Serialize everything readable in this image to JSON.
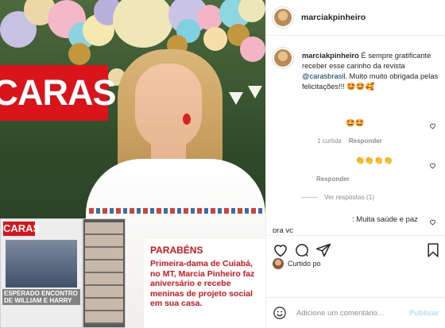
{
  "post": {
    "username": "marciakpinheiro",
    "image": {
      "brand": "CARAS",
      "mini_cover_brand": "CARAS",
      "mini_cover_headline": "ESPERADO ENCONTRO DE WILLIAM E HARRY",
      "caption_title": "PARABÉNS",
      "caption_text": "Primeira-dama de Cuiabá, no MT, Marcia Pinheiro faz aniversário e recebe meninas de projeto social em sua casa."
    },
    "caption": {
      "username": "marciakpinheiro",
      "text_before": "É sempre gratificante receber esse carinho da revista",
      "mention": "@carasbrasil",
      "text_after": ". Muito muito obrigada pelas felicitações!!! 🤩🤩🥰"
    },
    "comments": [
      {
        "text": "🤩🤩",
        "meta_likes": "1 curtida",
        "meta_reply": "Responder"
      },
      {
        "text": "👏👏👏👏",
        "meta_reply": "Responder",
        "view_replies": "Ver respostas (1)"
      },
      {
        "text": ": Muita saúde e paz pra vc"
      }
    ],
    "liked_by": "Curtido po",
    "add_comment_placeholder": "Adicione um comentário...",
    "publish_label": "Publicar"
  },
  "icons": {
    "like": "heart-icon",
    "comment": "comment-icon",
    "share": "share-icon",
    "save": "bookmark-icon",
    "emoji": "emoji-icon"
  },
  "colors": {
    "brand_red": "#d9141b",
    "link_blue": "#00376b",
    "muted": "#8e8e8e",
    "publish_disabled": "#b2dffc"
  }
}
